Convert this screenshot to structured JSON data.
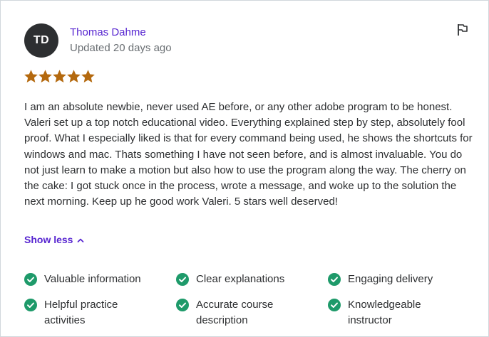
{
  "review": {
    "avatar_initials": "TD",
    "reviewer_name": "Thomas Dahme",
    "updated_text": "Updated 20 days ago",
    "rating": 5,
    "rating_max": 5,
    "body": "I am an absolute newbie, never used AE before, or any other adobe program to be honest. Valeri set up a top notch educational video. Everything explained step by step, absolutely fool proof. What I especially liked is that for every command being used, he shows the shortcuts for windows and mac. Thats something I have not seen before, and is almost invaluable. You do not just learn to make a motion but also how to use the program along the way. The cherry on the cake: I got stuck once in the process, wrote a message, and woke up to the solution the next morning. Keep up he good work Valeri. 5 stars well deserved!",
    "show_less_label": "Show less",
    "tags": [
      {
        "label": "Valuable information"
      },
      {
        "label": "Clear explanations"
      },
      {
        "label": "Engaging delivery"
      },
      {
        "label": "Helpful practice activities"
      },
      {
        "label": "Accurate course description"
      },
      {
        "label": "Knowledgeable instructor"
      }
    ]
  },
  "icons": {
    "flag": "flag-icon",
    "star": "star-icon",
    "chevron": "chevron-up-icon",
    "check": "check-circle-icon"
  },
  "colors": {
    "accent": "#5624d0",
    "star": "#b4690e",
    "check": "#1e9a6a",
    "avatar_bg": "#2d2f31"
  }
}
